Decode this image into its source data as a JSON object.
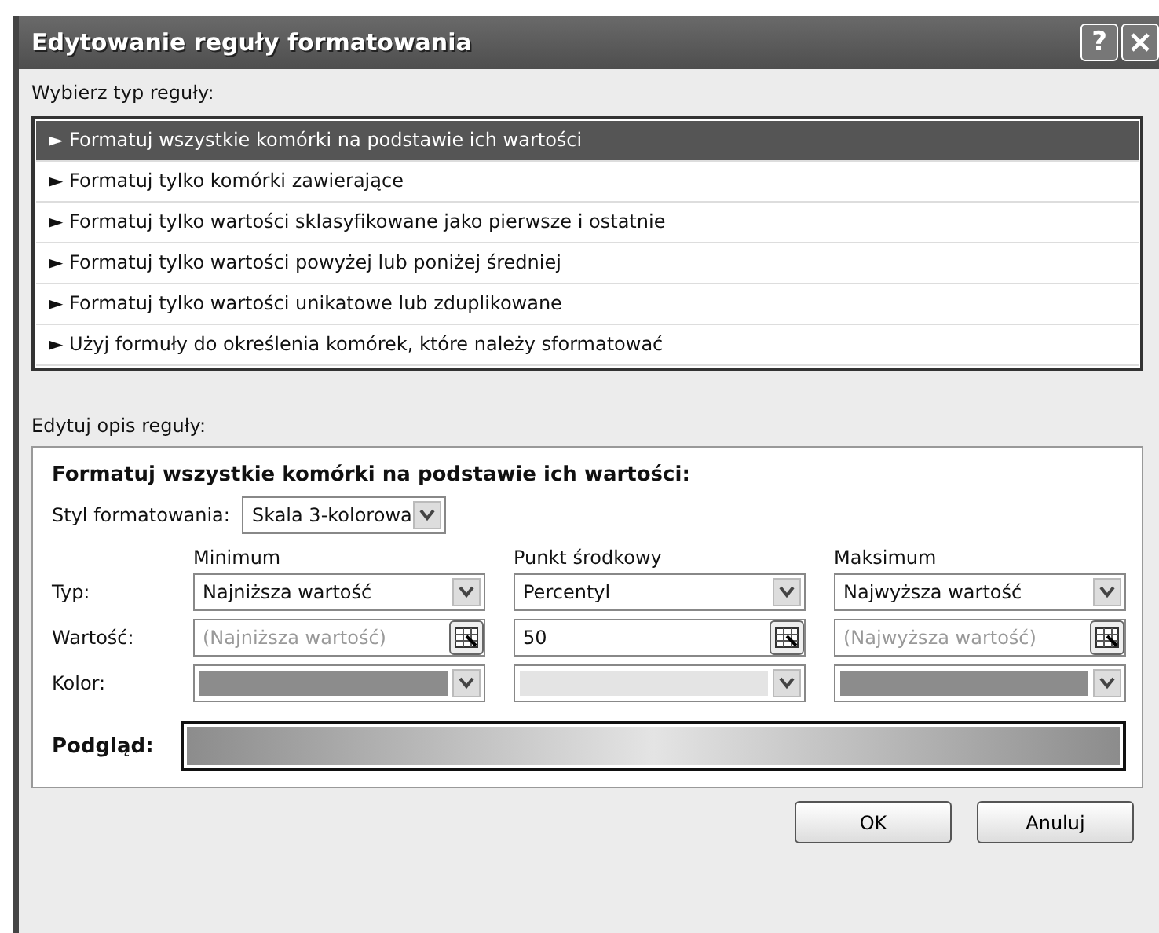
{
  "window": {
    "title": "Edytowanie reguły formatowania",
    "help": "?"
  },
  "rule_types": {
    "label": "Wybierz typ reguły:",
    "items": [
      {
        "text": "► Formatuj wszystkie komórki na podstawie ich wartości",
        "selected": true
      },
      {
        "text": "► Formatuj tylko komórki zawierające",
        "selected": false
      },
      {
        "text": "► Formatuj tylko wartości sklasyfikowane jako pierwsze i ostatnie",
        "selected": false
      },
      {
        "text": "► Formatuj tylko wartości powyżej lub poniżej średniej",
        "selected": false
      },
      {
        "text": "► Formatuj tylko wartości unikatowe lub zduplikowane",
        "selected": false
      },
      {
        "text": "► Użyj formuły do określenia komórek, które należy sformatować",
        "selected": false
      }
    ]
  },
  "description": {
    "label": "Edytuj opis reguły:",
    "heading": "Formatuj wszystkie komórki na podstawie ich wartości:",
    "style": {
      "label": "Styl formatowania:",
      "value": "Skala 3-kolorowa"
    },
    "row_labels": [
      "Typ:",
      "Wartość:",
      "Kolor:"
    ],
    "columns": [
      {
        "header": "Minimum",
        "type": "Najniższa wartość",
        "value": "(Najniższa wartość)",
        "disabled": true,
        "color": "#8c8c8c"
      },
      {
        "header": "Punkt środkowy",
        "type": "Percentyl",
        "value": "50",
        "disabled": false,
        "color": "#e4e4e4"
      },
      {
        "header": "Maksimum",
        "type": "Najwyższa wartość",
        "value": "(Najwyższa wartość)",
        "disabled": true,
        "color": "#8c8c8c"
      }
    ],
    "preview_label": "Podgląd:"
  },
  "buttons": [
    "OK",
    "Anuluj"
  ]
}
